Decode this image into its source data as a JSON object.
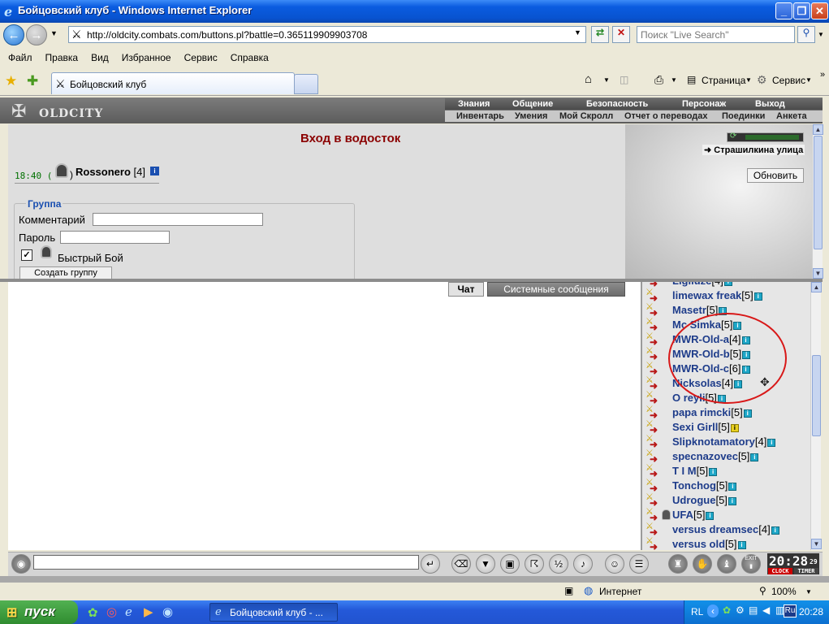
{
  "window": {
    "title": "Бойцовский клуб - Windows Internet Explorer",
    "min_glyph": "_",
    "max_glyph": "❐",
    "close_glyph": "✕"
  },
  "address": {
    "url": "http://oldcity.combats.com/buttons.pl?battle=0.365119909903708",
    "search_placeholder": "Поиск \"Live Search\""
  },
  "menu": [
    "Файл",
    "Правка",
    "Вид",
    "Избранное",
    "Сервис",
    "Справка"
  ],
  "tabs": {
    "active_label": "Бойцовский клуб",
    "page_label": "Страница",
    "tools_label": "Сервис"
  },
  "game": {
    "logo": "OLDCITY",
    "top_menu": [
      "Знания",
      "Общение",
      "Безопасность",
      "Персонаж",
      "Выход"
    ],
    "sub_menu": [
      "Инвентарь",
      "Умения",
      "Мой Скролл",
      "Отчет о переводах",
      "Поединки",
      "Анкета"
    ],
    "location_title": "Вход в водосток",
    "clock": "18:40",
    "player_name": "Rossonero",
    "player_level": "[4]",
    "street_link": "Страшилкина улица",
    "refresh_label": "Обновить",
    "group": {
      "legend": "Группа",
      "comment_label": "Комментарий",
      "password_label": "Пароль",
      "quick_fight_label": "Быстрый Бой",
      "create_label": "Создать группу"
    },
    "chat_tab": "Чат",
    "system_tab": "Системные сообщения"
  },
  "users": [
    {
      "name": "Ligiluze",
      "level": "[4]"
    },
    {
      "name": "limewax freak",
      "level": "[5]"
    },
    {
      "name": "Masetr",
      "level": "[5]"
    },
    {
      "name": "Mc Simka",
      "level": "[5]"
    },
    {
      "name": "MWR-Old-a",
      "level": "[4]"
    },
    {
      "name": "MWR-Old-b",
      "level": "[5]"
    },
    {
      "name": "MWR-Old-c",
      "level": "[6]"
    },
    {
      "name": "Nicksolas",
      "level": "[4]"
    },
    {
      "name": "O reyli",
      "level": "[5]"
    },
    {
      "name": "papa rimcki",
      "level": "[5]"
    },
    {
      "name": "Sexi Girll",
      "level": "[5]"
    },
    {
      "name": "Slipknotamatory",
      "level": "[4]"
    },
    {
      "name": "specnazovec",
      "level": "[5]"
    },
    {
      "name": "T I M",
      "level": "[5]"
    },
    {
      "name": "Tonchog",
      "level": "[5]"
    },
    {
      "name": "Udrogue",
      "level": "[5]"
    },
    {
      "name": "UFA",
      "level": "[5]"
    },
    {
      "name": "versus dreamsec",
      "level": "[4]"
    },
    {
      "name": "versus old",
      "level": "[5]"
    }
  ],
  "bottom": {
    "clock": "20:28",
    "clock_seconds": "29",
    "clock_label": "CLOCK",
    "timer_label": "TIMER",
    "exit_label": "EXIT"
  },
  "status": {
    "zone": "Интернет",
    "zoom": "100%"
  },
  "taskbar": {
    "start": "пуск",
    "task": "Бойцовский клуб - ...",
    "lang1": "RL",
    "lang2": "Ru",
    "time": "20:28"
  },
  "colors": {
    "accent_blue": "#1e3c8a",
    "location_red": "#8b0000",
    "highlight_circle": "#d81818"
  }
}
